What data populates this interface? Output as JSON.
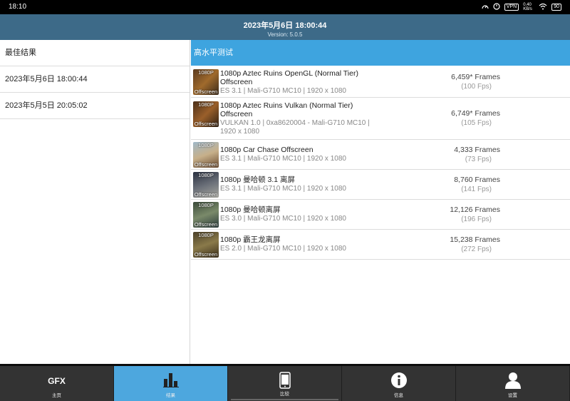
{
  "status_bar": {
    "time": "18:10",
    "icons": [
      "speed-icon",
      "timer-icon",
      "vpn-badge",
      "net-rate",
      "wifi-icon",
      "battery-icon"
    ],
    "vpn": "VPN",
    "net_rate": "0.40 KB/s",
    "battery": "90"
  },
  "header": {
    "title": "2023年5月6日 18:00:44",
    "version": "Version: 5.0.5"
  },
  "left": {
    "items": [
      "最佳结果",
      "2023年5月6日 18:00:44",
      "2023年5月5日 20:05:02"
    ]
  },
  "right": {
    "title": "高水平测试",
    "results": [
      {
        "thumb_top": "1080P",
        "thumb_bottom": "Offscreen",
        "name": "1080p Aztec Ruins OpenGL (Normal Tier) Offscreen",
        "sub": "ES 3.1 | Mali-G710 MC10 | 1920 x 1080",
        "frames": "6,459* Frames",
        "fps": "(100 Fps)"
      },
      {
        "thumb_top": "1080P",
        "thumb_bottom": "Offscreen",
        "name": "1080p Aztec Ruins Vulkan (Normal Tier) Offscreen",
        "sub": "VULKAN 1.0 | 0xa8620004 - Mali-G710 MC10 | 1920 x 1080",
        "frames": "6,749* Frames",
        "fps": "(105 Fps)"
      },
      {
        "thumb_top": "1080P",
        "thumb_bottom": "Offscreen",
        "name": "1080p Car Chase Offscreen",
        "sub": "ES 3.1 | Mali-G710 MC10 | 1920 x 1080",
        "frames": "4,333 Frames",
        "fps": "(73 Fps)"
      },
      {
        "thumb_top": "1080P",
        "thumb_bottom": "Offscreen",
        "name": "1080p 曼哈顿 3.1 离屏",
        "sub": "ES 3.1 | Mali-G710 MC10 | 1920 x 1080",
        "frames": "8,760 Frames",
        "fps": "(141 Fps)"
      },
      {
        "thumb_top": "1080P",
        "thumb_bottom": "Offscreen",
        "name": "1080p 曼哈顿离屏",
        "sub": "ES 3.0 | Mali-G710 MC10 | 1920 x 1080",
        "frames": "12,126 Frames",
        "fps": "(196 Fps)"
      },
      {
        "thumb_top": "1080P",
        "thumb_bottom": "Offscreen",
        "name": "1080p 霸王龙离屏",
        "sub": "ES 2.0 | Mali-G710 MC10 | 1920 x 1080",
        "frames": "15,238 Frames",
        "fps": "(272 Fps)"
      }
    ]
  },
  "bottom_nav": {
    "items": [
      {
        "label": "主页",
        "icon": "gfx-logo",
        "text": "GFX"
      },
      {
        "label": "结果",
        "icon": "bar-chart-icon"
      },
      {
        "label": "比较",
        "icon": "phone-icon"
      },
      {
        "label": "信息",
        "icon": "info-icon"
      },
      {
        "label": "设置",
        "icon": "user-icon"
      }
    ],
    "active_index": 1
  },
  "colors": {
    "header": "#3d6a88",
    "accent": "#3ea4df",
    "nav_bg": "#333333"
  }
}
